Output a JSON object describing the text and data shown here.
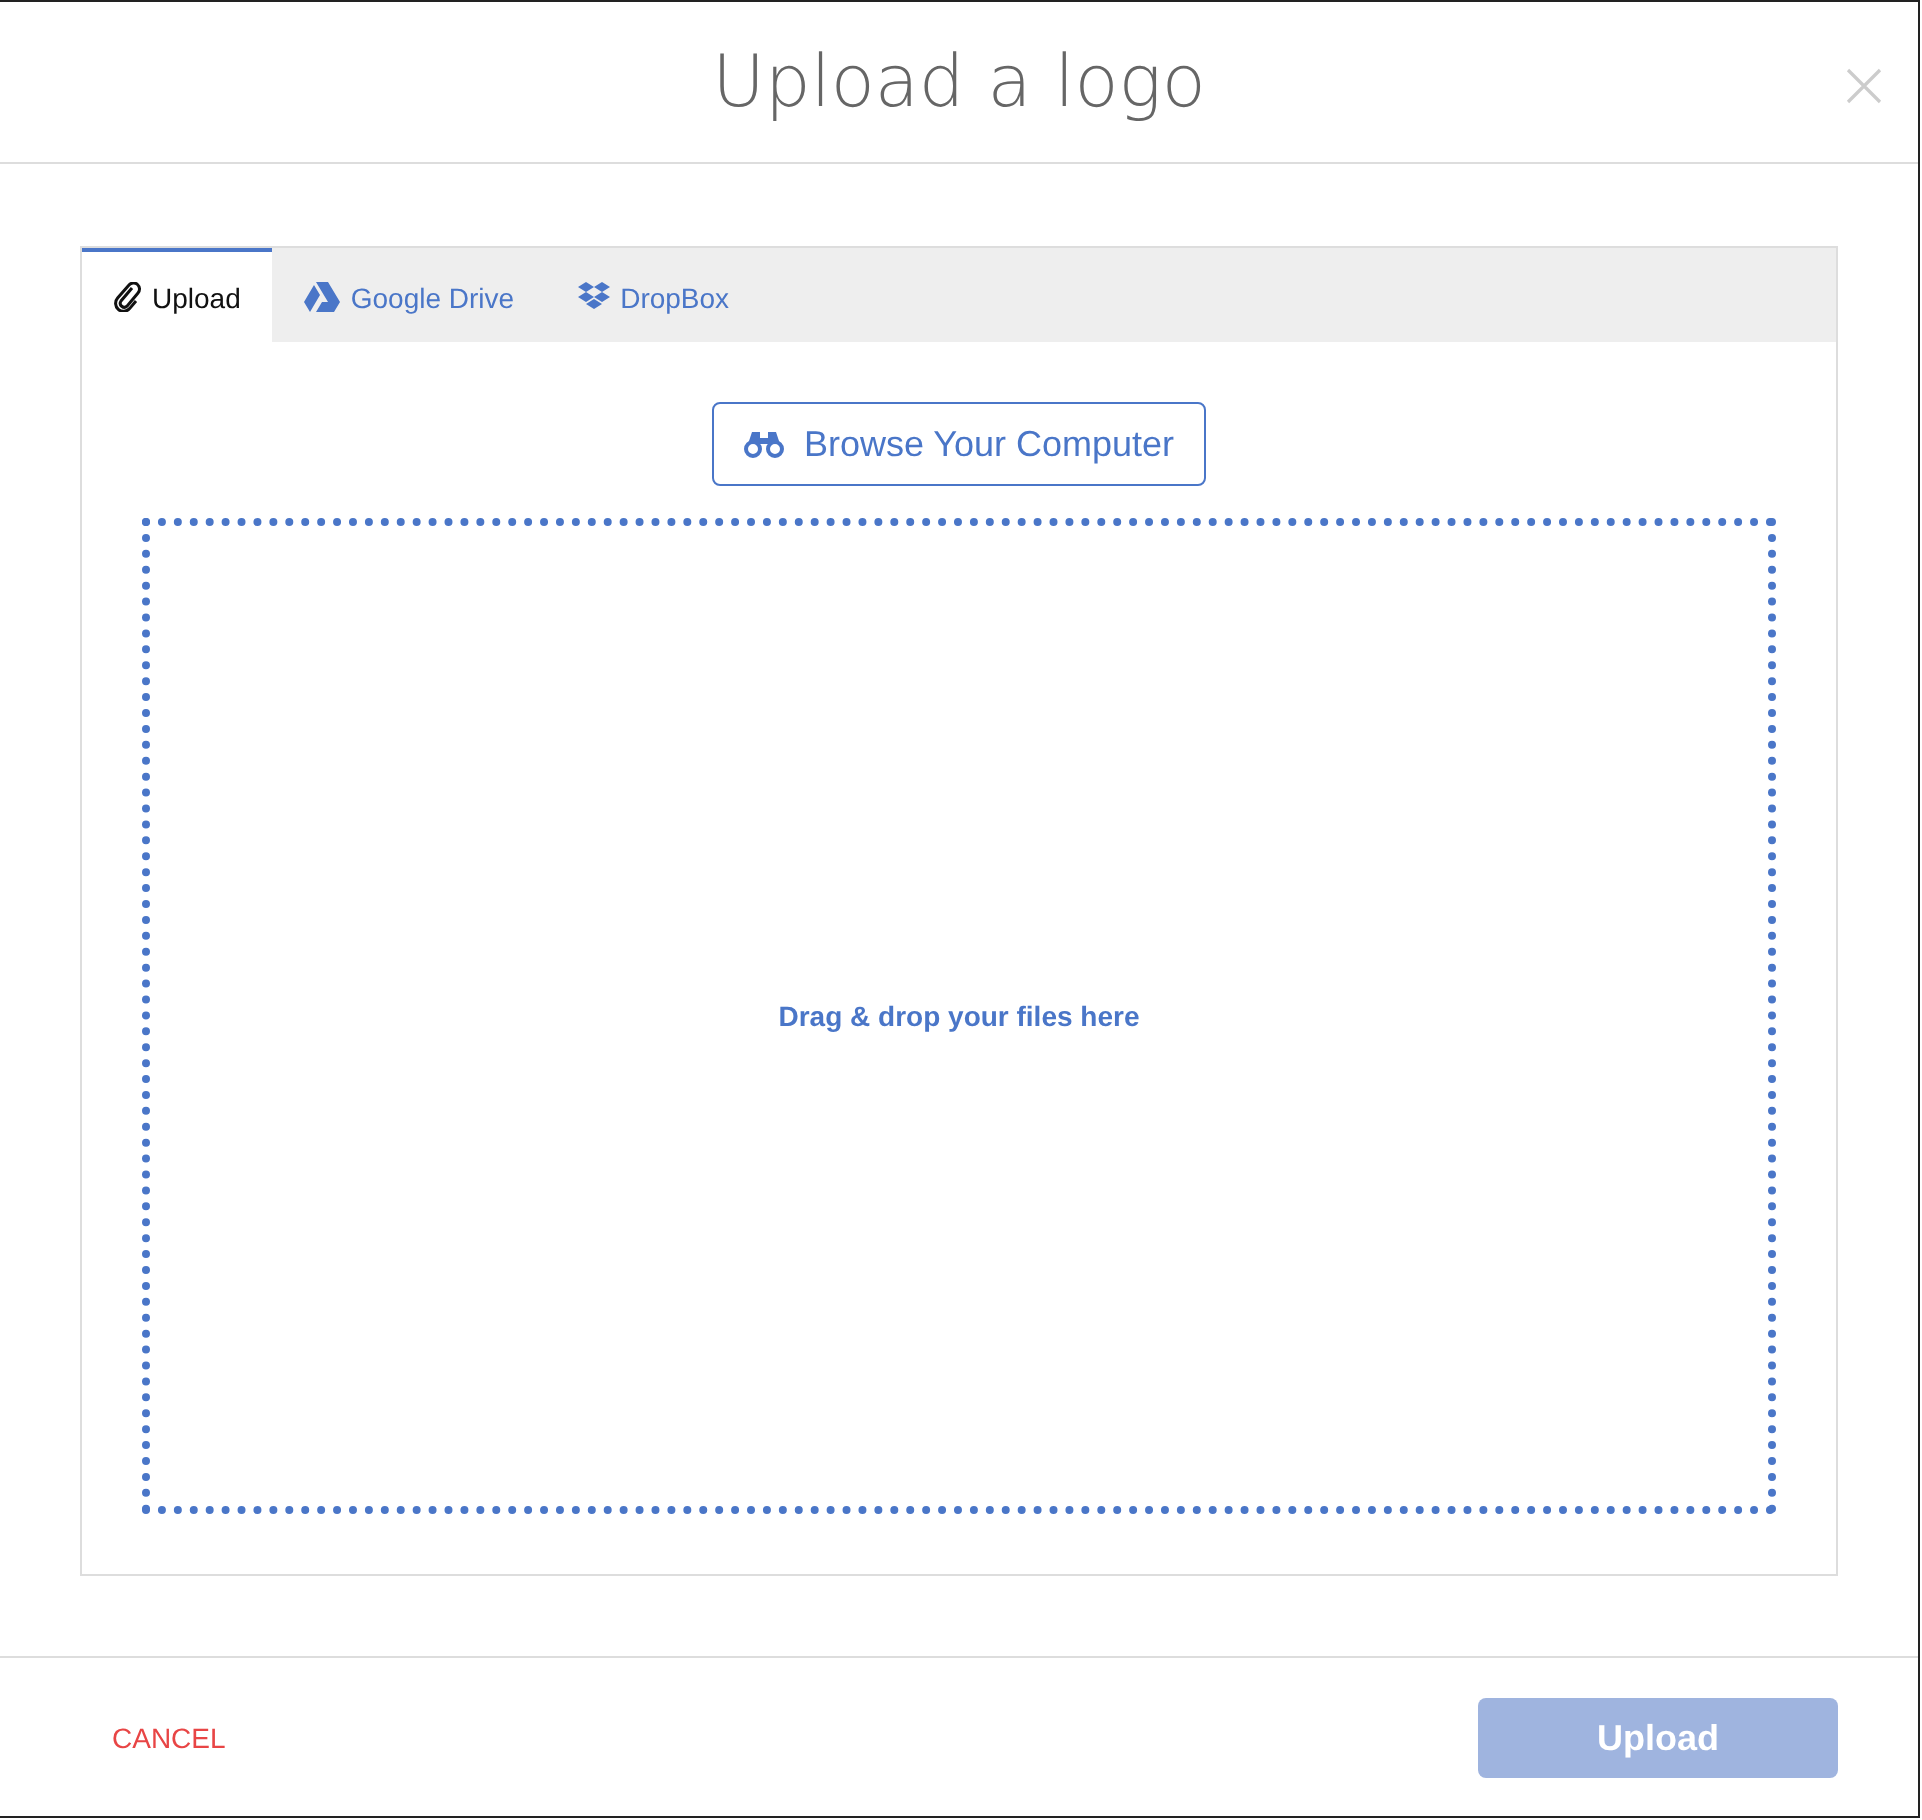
{
  "dialog": {
    "title": "Upload a logo"
  },
  "tabs": [
    {
      "label": "Upload",
      "kind": "clip",
      "selected": true
    },
    {
      "label": "Google Drive",
      "kind": "drive",
      "selected": false
    },
    {
      "label": "DropBox",
      "kind": "dropbox",
      "selected": false
    }
  ],
  "browse_button": {
    "label": "Browse Your Computer"
  },
  "dropzone": {
    "text": "Drag & drop your files here"
  },
  "footer": {
    "cancel": "CANCEL",
    "upload": {
      "label": "Upload",
      "disabled": true
    }
  }
}
